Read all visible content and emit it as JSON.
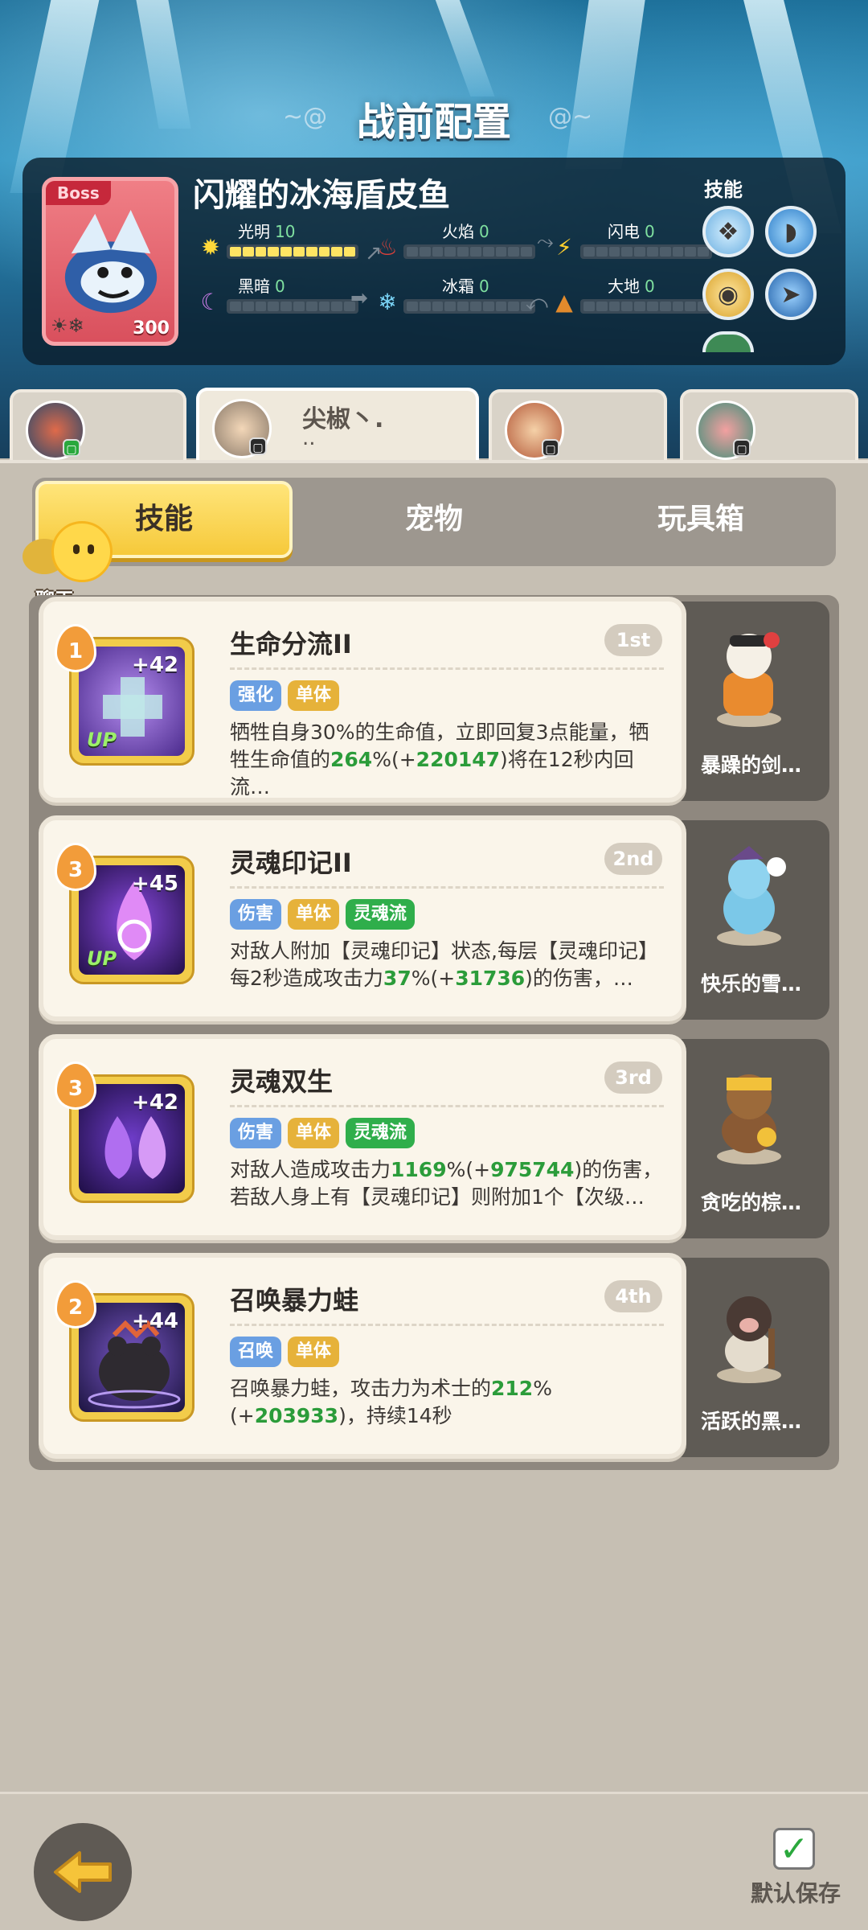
{
  "page_title": "战前配置",
  "boss": {
    "tag": "Boss",
    "name": "闪耀的冰海盾皮鱼",
    "level": "300",
    "stats": [
      {
        "label": "光明",
        "value": "10",
        "icon": "sun-icon",
        "fill": 1.0
      },
      {
        "label": "火焰",
        "value": "0",
        "icon": "flame-icon",
        "fill": 0
      },
      {
        "label": "闪电",
        "value": "0",
        "icon": "lightning-icon",
        "fill": 0
      },
      {
        "label": "黑暗",
        "value": "0",
        "icon": "moon-icon",
        "fill": 0
      },
      {
        "label": "冰霜",
        "value": "0",
        "icon": "snowflake-icon",
        "fill": 0
      },
      {
        "label": "大地",
        "value": "0",
        "icon": "earth-icon",
        "fill": 0
      }
    ],
    "skills_label": "技能"
  },
  "hero_tabs": [
    {
      "name": "",
      "sub": "",
      "active": false
    },
    {
      "name": "尖椒丶.",
      "sub": "..",
      "active": true
    },
    {
      "name": "",
      "sub": "",
      "active": false
    },
    {
      "name": "",
      "sub": "",
      "active": false
    }
  ],
  "tabs": {
    "skills": "技能",
    "pets": "宠物",
    "toybox": "玩具箱"
  },
  "chat_label": "聊天",
  "skills": [
    {
      "level": "1",
      "plus": "+42",
      "up": "UP",
      "name": "生命分流II",
      "order": "1st",
      "tags": [
        "强化",
        "单体"
      ],
      "desc_1": "牺牲自身30%的生命值，立即回复3点能量，牺牲生命值的",
      "desc_pct": "264",
      "desc_2": "%(+",
      "desc_val": "220147",
      "desc_3": ")将在12秒内回流…",
      "pet_name": "暴躁的剑…"
    },
    {
      "level": "3",
      "plus": "+45",
      "up": "UP",
      "name": "灵魂印记II",
      "order": "2nd",
      "tags": [
        "伤害",
        "单体",
        "灵魂流"
      ],
      "desc_1": "对敌人附加【灵魂印记】状态,每层【灵魂印记】每2秒造成攻击力",
      "desc_pct": "37",
      "desc_2": "%(+",
      "desc_val": "31736",
      "desc_3": ")的伤害，…",
      "pet_name": "快乐的雪…"
    },
    {
      "level": "3",
      "plus": "+42",
      "up": "",
      "name": "灵魂双生",
      "order": "3rd",
      "tags": [
        "伤害",
        "单体",
        "灵魂流"
      ],
      "desc_1": "对敌人造成攻击力",
      "desc_pct": "1169",
      "desc_2": "%(+",
      "desc_val": "975744",
      "desc_3": ")的伤害，若敌人身上有【灵魂印记】则附加1个【次级…",
      "pet_name": "贪吃的棕…"
    },
    {
      "level": "2",
      "plus": "+44",
      "up": "",
      "name": "召唤暴力蛙",
      "order": "4th",
      "tags": [
        "召唤",
        "单体"
      ],
      "desc_1": "召唤暴力蛙，攻击力为术士的",
      "desc_pct": "212",
      "desc_2": "%(+",
      "desc_val": "203933",
      "desc_3": ")，持续14秒",
      "pet_name": "活跃的黑…"
    }
  ],
  "bottom": {
    "save_label": "默认保存",
    "save_checked": true
  }
}
